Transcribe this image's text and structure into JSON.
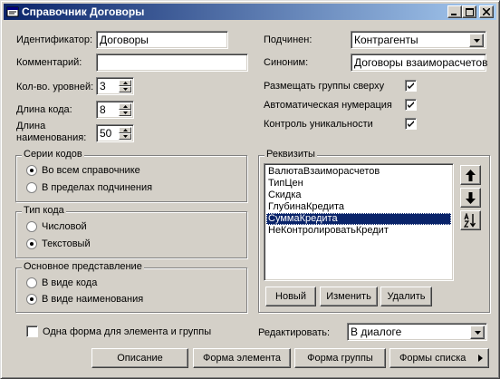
{
  "window": {
    "title": "Справочник Договоры",
    "controls": [
      "minimize-icon",
      "maximize-icon",
      "close-icon"
    ]
  },
  "form": {
    "id_label": "Идентификатор:",
    "id_value": "Договоры",
    "comment_label": "Комментарий:",
    "comment_value": "",
    "levels_label": "Кол-во. уровней:",
    "levels_value": "3",
    "code_len_label": "Длина кода:",
    "code_len_value": "8",
    "name_len_label_line1": "Длина",
    "name_len_label_line2": "наименования:",
    "name_len_value": "50",
    "subordinate_label": "Подчинен:",
    "subordinate_value": "Контрагенты",
    "synonym_label": "Синоним:",
    "synonym_value": "Договоры взаиморасчетов",
    "groups_top_label": "Размещать группы сверху",
    "groups_top_checked": true,
    "auto_number_label": "Автоматическая нумерация",
    "auto_number_checked": true,
    "uniqueness_label": "Контроль уникальности",
    "uniqueness_checked": true
  },
  "code_series": {
    "title": "Серии кодов",
    "options": [
      "Во всем справочнике",
      "В пределах подчинения"
    ],
    "selected": 0
  },
  "code_type": {
    "title": "Тип кода",
    "options": [
      "Числовой",
      "Текстовый"
    ],
    "selected": 1
  },
  "main_view": {
    "title": "Основное представление",
    "options": [
      "В виде кода",
      "В виде наименования"
    ],
    "selected": 1
  },
  "attributes": {
    "title": "Реквизиты",
    "items": [
      "ВалютаВзаиморасчетов",
      "ТипЦен",
      "Скидка",
      "ГлубинаКредита",
      "СуммаКредита",
      "НеКонтролироватьКредит"
    ],
    "selected": 4,
    "buttons": {
      "new": "Новый",
      "edit": "Изменить",
      "delete": "Удалить"
    },
    "side_icons": [
      "arrow-up-icon",
      "arrow-down-icon",
      "sort-az-icon"
    ]
  },
  "bottom": {
    "one_form_label": "Одна форма для элемента и группы",
    "one_form_checked": false,
    "edit_label": "Редактировать:",
    "edit_value": "В диалоге",
    "buttons": {
      "description": "Описание",
      "element_form": "Форма элемента",
      "group_form": "Форма группы",
      "list_forms": "Формы списка"
    }
  },
  "colors": {
    "face": "#d4d0c8",
    "title_start": "#0a246a",
    "title_end": "#a6caf0",
    "selection": "#0a246a"
  }
}
